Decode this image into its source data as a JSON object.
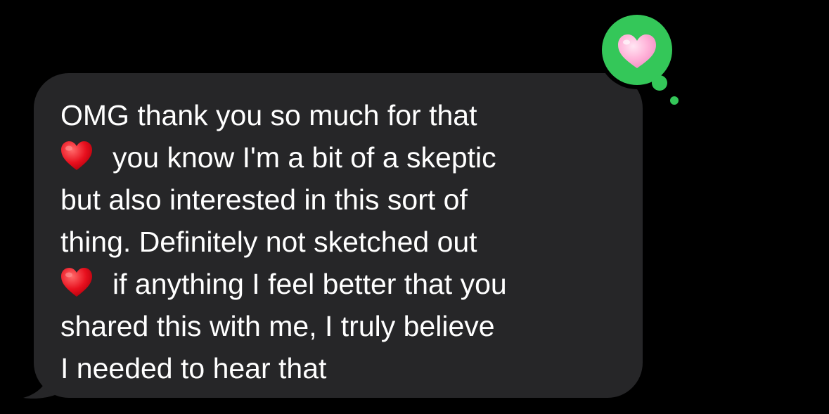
{
  "message": {
    "lines": [
      {
        "text": "OMG thank you so much for that",
        "emoji": ""
      },
      {
        "text": "you know I'm a bit of a skeptic",
        "emoji": "red-heart-icon"
      },
      {
        "text": "but also interested in this sort of",
        "emoji": ""
      },
      {
        "text": "thing. Definitely not sketched out",
        "emoji": ""
      },
      {
        "text": "if anything I feel better that you",
        "emoji": "red-heart-icon"
      },
      {
        "text": "shared this with me, I truly believe",
        "emoji": ""
      },
      {
        "text": "I needed to hear that",
        "emoji": ""
      }
    ],
    "bubble_color": "#262628",
    "text_color": "#ffffff"
  },
  "tapback": {
    "icon": "pink-heart-icon",
    "bubble_color": "#34c759",
    "heart_color": "#ffb3d9"
  },
  "background_color": "#000000"
}
